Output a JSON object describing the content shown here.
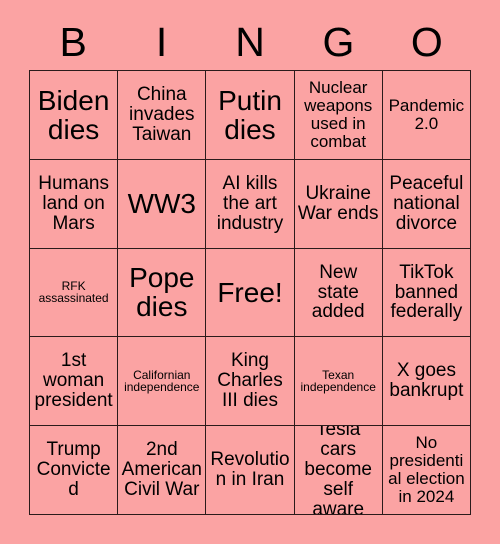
{
  "card": {
    "title": "BINGO",
    "background_color": "#fba3a3",
    "border_color": "#2b1b1b",
    "text_color": "#000000"
  },
  "header": {
    "letters": [
      "B",
      "I",
      "N",
      "G",
      "O"
    ]
  },
  "grid": {
    "columns": 5,
    "rows": 5,
    "cells": [
      {
        "text": "Biden dies",
        "size": "fs-xxl"
      },
      {
        "text": "China invades Taiwan",
        "size": "fs-lg"
      },
      {
        "text": "Putin dies",
        "size": "fs-xxl"
      },
      {
        "text": "Nuclear weapons used in combat",
        "size": "fs-md"
      },
      {
        "text": "Pandemic 2.0",
        "size": "fs-md"
      },
      {
        "text": "Humans land on Mars",
        "size": "fs-lg"
      },
      {
        "text": "WW3",
        "size": "fs-xxl"
      },
      {
        "text": "AI kills the art industry",
        "size": "fs-lg"
      },
      {
        "text": "Ukraine War ends",
        "size": "fs-lg"
      },
      {
        "text": "Peaceful national divorce",
        "size": "fs-lg"
      },
      {
        "text": "RFK assassinated",
        "size": "fs-sm"
      },
      {
        "text": "Pope dies",
        "size": "fs-xxl"
      },
      {
        "text": "Free!",
        "size": "fs-xxl"
      },
      {
        "text": "New state added",
        "size": "fs-lg"
      },
      {
        "text": "TikTok banned federally",
        "size": "fs-lg"
      },
      {
        "text": "1st woman president",
        "size": "fs-lg"
      },
      {
        "text": "Californian independence",
        "size": "fs-sm"
      },
      {
        "text": "King Charles III dies",
        "size": "fs-lg"
      },
      {
        "text": "Texan independence",
        "size": "fs-sm"
      },
      {
        "text": "X goes bankrupt",
        "size": "fs-lg"
      },
      {
        "text": "Trump Convicted",
        "size": "fs-lg"
      },
      {
        "text": "2nd American Civil War",
        "size": "fs-lg"
      },
      {
        "text": "Revolution in Iran",
        "size": "fs-lg"
      },
      {
        "text": "Tesla cars become self aware",
        "size": "fs-lg"
      },
      {
        "text": "No presidential election in 2024",
        "size": "fs-md"
      }
    ]
  }
}
